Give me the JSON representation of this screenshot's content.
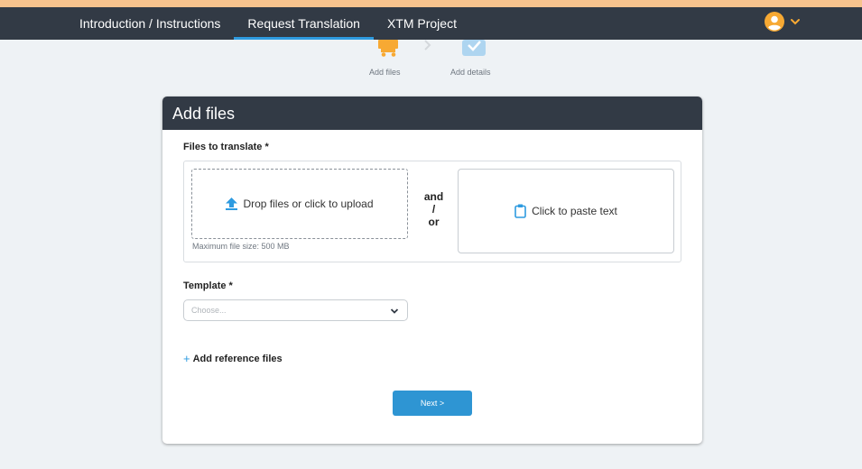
{
  "nav": {
    "tabs": [
      {
        "label": "Introduction / Instructions",
        "active": false
      },
      {
        "label": "Request Translation",
        "active": true
      },
      {
        "label": "XTM Project",
        "active": false
      }
    ],
    "user_icon": "user-avatar-icon",
    "menu_icon": "chevron-down-icon"
  },
  "steps": [
    {
      "label": "Add files",
      "icon": "cart-icon"
    },
    {
      "label": "Add details",
      "icon": "checkbox-icon"
    }
  ],
  "card": {
    "title": "Add files",
    "files_label": "Files to translate *",
    "dropzone_text": "Drop files or click to upload",
    "max_size_text": "Maximum file size: 500 MB",
    "and_or": [
      "and",
      "/",
      "or"
    ],
    "paste_text": "Click to paste text",
    "template_label": "Template *",
    "template_placeholder": "Choose...",
    "add_reference_label": "Add reference files",
    "next_label": "Next >"
  },
  "colors": {
    "nav_bg": "#323a45",
    "accent_blue": "#2e9be0",
    "accent_orange": "#f7a933",
    "top_strip": "#f7c38d",
    "page_bg": "#eef2f5"
  }
}
